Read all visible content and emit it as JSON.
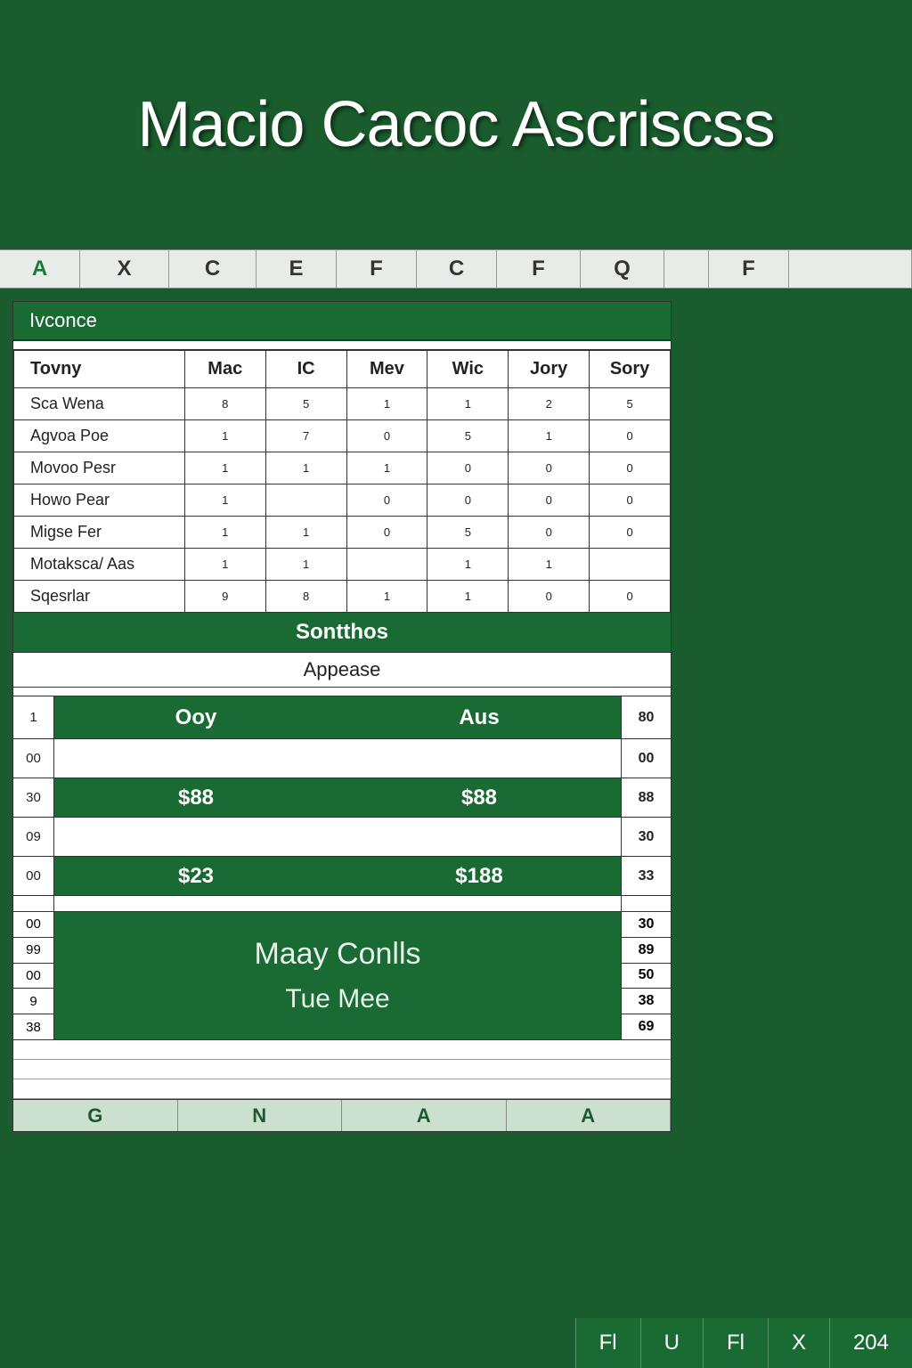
{
  "header": {
    "title": "Macio Cacoc Ascriscss"
  },
  "ruler_top": [
    "A",
    "X",
    "C",
    "E",
    "F",
    "C",
    "F",
    "Q",
    "",
    "F",
    ""
  ],
  "section1_title": "Ivconce",
  "table": {
    "headers": [
      "Tovny",
      "Mac",
      "IC",
      "Mev",
      "Wic",
      "Jory",
      "Sory"
    ],
    "rows": [
      [
        "Sca Wena",
        "8",
        "5",
        "1",
        "1",
        "2",
        "5"
      ],
      [
        "Agvoa Poe",
        "1",
        "7",
        "0",
        "5",
        "1",
        "0"
      ],
      [
        "Movoo Pesr",
        "1",
        "1",
        "1",
        "0",
        "0",
        "0"
      ],
      [
        "Howo Pear",
        "1",
        "",
        "0",
        "0",
        "0",
        "0"
      ],
      [
        "Migse Fer",
        "1",
        "1",
        "0",
        "5",
        "0",
        "0"
      ],
      [
        "Motaksca/ Aas",
        "1",
        "1",
        "",
        "1",
        "1",
        ""
      ],
      [
        "Sqesrlar",
        "9",
        "8",
        "1",
        "1",
        "0",
        "0"
      ]
    ]
  },
  "section2_title": "Sontthos",
  "section2_sub": "Appease",
  "lower": {
    "header": {
      "left": "1",
      "midA": "Ooy",
      "midB": "Aus",
      "right": "80"
    },
    "rows": [
      {
        "left": "00",
        "midA": "",
        "midB": "",
        "right": "00",
        "green": false
      },
      {
        "left": "30",
        "midA": "$88",
        "midB": "$88",
        "right": "88",
        "green": true
      },
      {
        "left": "09",
        "midA": "",
        "midB": "",
        "right": "30",
        "green": false
      },
      {
        "left": "00",
        "midA": "$23",
        "midB": "$188",
        "right": "33",
        "green": true
      },
      {
        "left": "",
        "midA": "",
        "midB": "",
        "right": "",
        "green": false,
        "thin": true
      }
    ]
  },
  "summary": {
    "left": [
      "00",
      "99",
      "00",
      "9",
      "38"
    ],
    "line1": "Maay Conlls",
    "line2": "Tue Mee",
    "right": [
      "30",
      "89",
      "50",
      "38",
      "69"
    ]
  },
  "ruler_bottom": [
    "G",
    "N",
    "A",
    "A"
  ],
  "status": [
    "Fl",
    "U",
    "Fl",
    "X",
    "204"
  ]
}
